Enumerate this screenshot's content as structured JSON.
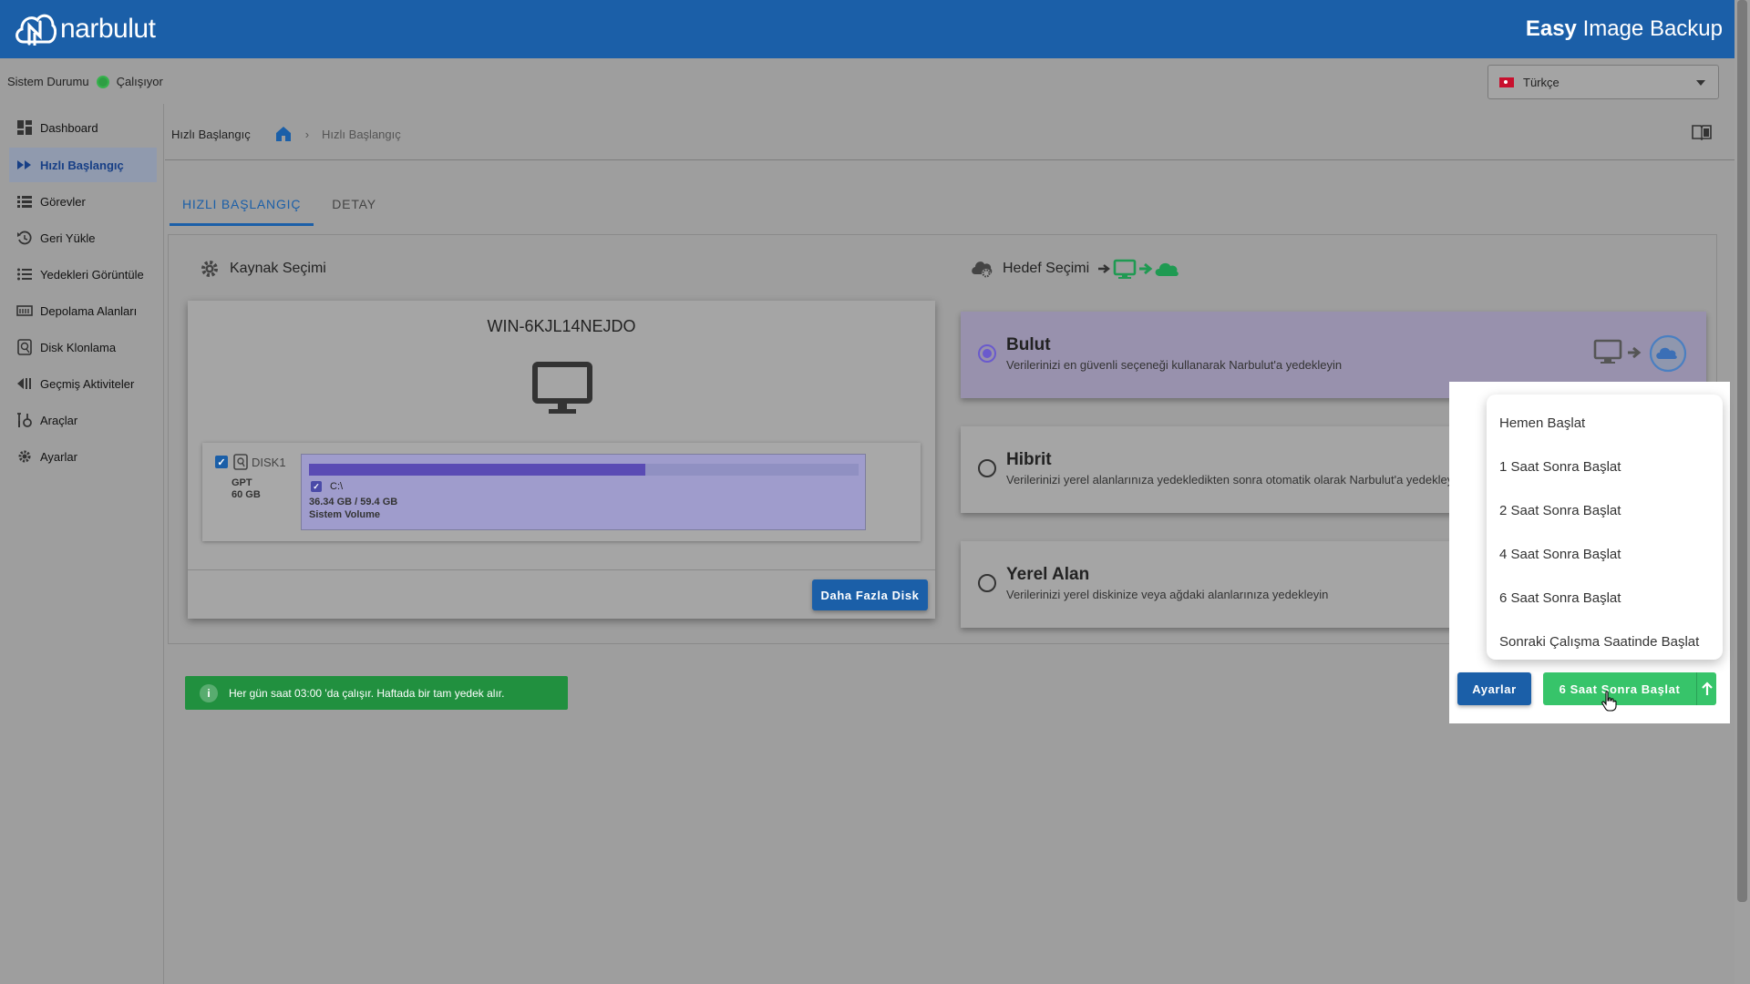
{
  "header": {
    "logo_text": "narbulut",
    "app_title_bold": "Easy",
    "app_title_rest": "Image Backup"
  },
  "status": {
    "label": "Sistem Durumu",
    "value": "Çalışıyor",
    "color": "#2e9e44"
  },
  "language": {
    "selected": "Türkçe"
  },
  "sidebar": {
    "items": [
      {
        "label": "Dashboard",
        "icon": "dashboard-icon"
      },
      {
        "label": "Hızlı Başlangıç",
        "icon": "fast-forward-icon",
        "active": true
      },
      {
        "label": "Görevler",
        "icon": "list-icon"
      },
      {
        "label": "Geri Yükle",
        "icon": "restore-icon"
      },
      {
        "label": "Yedekleri Görüntüle",
        "icon": "bullet-list-icon"
      },
      {
        "label": "Depolama Alanları",
        "icon": "storage-icon"
      },
      {
        "label": "Disk Klonlama",
        "icon": "disk-icon"
      },
      {
        "label": "Geçmiş Aktiviteler",
        "icon": "history-icon"
      },
      {
        "label": "Araçlar",
        "icon": "tools-icon"
      },
      {
        "label": "Ayarlar",
        "icon": "gear-icon"
      }
    ]
  },
  "breadcrumb": {
    "root": "Hızlı Başlangıç",
    "current": "Hızlı Başlangıç"
  },
  "tabs": [
    {
      "label": "HIZLI BAŞLANGIÇ"
    },
    {
      "label": "DETAY"
    }
  ],
  "source": {
    "title": "Kaynak Seçimi",
    "hostname": "WIN-6KJL14NEJDO",
    "disk": {
      "name": "DISK1",
      "scheme": "GPT",
      "size": "60 GB"
    },
    "volume": {
      "letter": "C:\\",
      "usage": "36.34 GB / 59.4 GB",
      "label": "Sistem Volume",
      "used_fraction": 0.612
    },
    "more_button": "Daha Fazla Disk"
  },
  "target": {
    "title": "Hedef Seçimi",
    "options": [
      {
        "title": "Bulut",
        "desc": "Verilerinizi en güvenli seçeneği kullanarak Narbulut'a yedekleyin",
        "selected": true
      },
      {
        "title": "Hibrit",
        "desc": "Verilerinizi yerel alanlarınıza yedekledikten sonra otomatik olarak Narbulut'a yedekleyin",
        "selected": false
      },
      {
        "title": "Yerel Alan",
        "desc": "Verilerinizi yerel diskinize veya ağdaki alanlarınıza yedekleyin",
        "selected": false
      }
    ]
  },
  "info": {
    "text": "Her gün saat 03:00 'da çalışır. Haftada bir tam yedek alır."
  },
  "actions": {
    "settings_button": "Ayarlar",
    "start_button": "6 Saat Sonra Başlat"
  },
  "start_menu": {
    "items": [
      "Hemen Başlat",
      "1 Saat Sonra Başlat",
      "2 Saat Sonra Başlat",
      "4 Saat Sonra Başlat",
      "6 Saat Sonra Başlat",
      "Sonraki Çalışma Saatinde Başlat"
    ]
  }
}
